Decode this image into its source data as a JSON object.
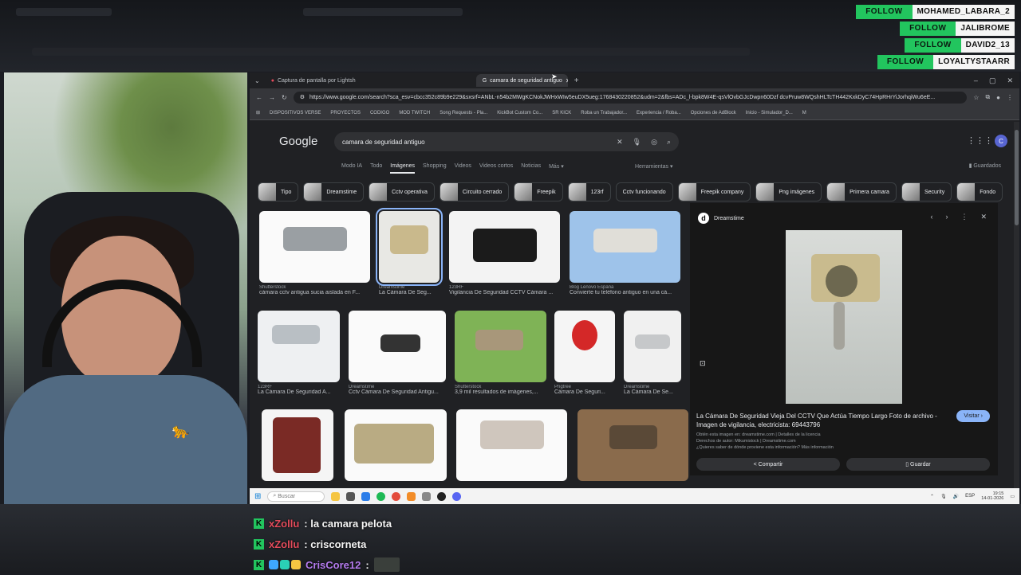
{
  "overlay": {
    "follows": [
      {
        "action": "FOLLOW",
        "user": "MOHAMED_LABARA_2"
      },
      {
        "action": "FOLLOW",
        "user": "JALIBROME"
      },
      {
        "action": "FOLLOW",
        "user": "DAVID2_13"
      },
      {
        "action": "FOLLOW",
        "user": "LOYALTYSTAARR"
      }
    ]
  },
  "browser": {
    "tabs": [
      {
        "label": "Captura de pantalla por Lightsh",
        "active": false
      },
      {
        "label": "camara de seguridad antiguo",
        "active": true
      }
    ],
    "url": "https://www.google.com/search?sca_esv=cbcc352c89b9e229&sxsrf=ANbL-n54b2MWgKCNokJWHxWIw5euDX5ueg:1768430220852&udm=2&fbs=ADc_l-bpk8W4E-qsVlOvbGJcDwpn60Dzf dcvPruw8WQshHLTcTH442KxkDyC74HpRHrYiJorhqiWu6eE...",
    "bookmarks": [
      "DISPOSITIVOS VERSE",
      "PROYECTOS",
      "CODIGO",
      "MOD TWITCH",
      "Song Requests - Pla...",
      "KickBot Custom Co...",
      "SR KICK",
      "Roba un Trabajador...",
      "Experiencia / Roba...",
      "Opciones de AdBlock",
      "Inicio - Simulador_D...",
      "M"
    ]
  },
  "google": {
    "logo": "Google",
    "query": "camara de seguridad antiguo",
    "avatar_letter": "C",
    "nav": [
      "Modo IA",
      "Todo",
      "Imágenes",
      "Shopping",
      "Videos",
      "Videos cortos",
      "Noticias",
      "Más ▾"
    ],
    "tools": "Herramientas ▾",
    "saved": "Guardados",
    "chips": [
      "Tipo",
      "Dreamstime",
      "Cctv operativa",
      "Circuito cerrado",
      "Freepik",
      "123rf",
      "Cctv funcionando",
      "Freepik company",
      "Png imágenes",
      "Primera camara",
      "Security",
      "Fondo"
    ],
    "results": [
      {
        "src": "Shutterstock",
        "cap": "cámara cctv antigua sucia aislada en F..."
      },
      {
        "src": "Dreamstime",
        "cap": "La Cámara De Seg..."
      },
      {
        "src": "123RF",
        "cap": "Vigilancia De Seguridad CCTV Cámara ..."
      },
      {
        "src": "Blog Lenovo España",
        "cap": "Convierte tu teléfono antiguo en una cá..."
      },
      {
        "src": "123RF",
        "cap": "La Cámara De Seguridad A..."
      },
      {
        "src": "Dreamstime",
        "cap": "Cctv Cámara De Seguridad Antigu..."
      },
      {
        "src": "Shutterstock",
        "cap": "3,9 mil resultados de imágenes,..."
      },
      {
        "src": "Pngtree",
        "cap": "Cámara De Seguri..."
      },
      {
        "src": "Dreamstime",
        "cap": "La Cámara De Se..."
      }
    ],
    "preview": {
      "site": "Dreamstime",
      "title": "La Cámara De Seguridad Vieja Del CCTV Que Actúa Tiempo Largo Foto de archivo - Imagen de vigilancia, electricista: 69443796",
      "meta1": "Obtén esta imagen en: dreamstime.com | Detalles de la licencia",
      "meta2": "Derechos de autor: Mikumistock | Dreamstime.com",
      "meta3": "¿Quieres saber de dónde proviene esta información? Más información",
      "visit": "Visitar ›",
      "share": "Compartir",
      "save": "Guardar"
    }
  },
  "taskbar": {
    "search": "Buscar",
    "lang": "ESP",
    "time": "19:15",
    "date": "14-01-2026"
  },
  "chat": [
    {
      "user": "xZollu",
      "text": ": la camara pelota"
    },
    {
      "user": "xZollu",
      "text": ": criscorneta"
    },
    {
      "user": "CrisCore12",
      "text": ":"
    }
  ],
  "colors": {
    "follow_green": "#22c55e",
    "chat_red": "#e34b5b",
    "chat_purple": "#b67cf0",
    "link_blue": "#8ab4f8"
  }
}
